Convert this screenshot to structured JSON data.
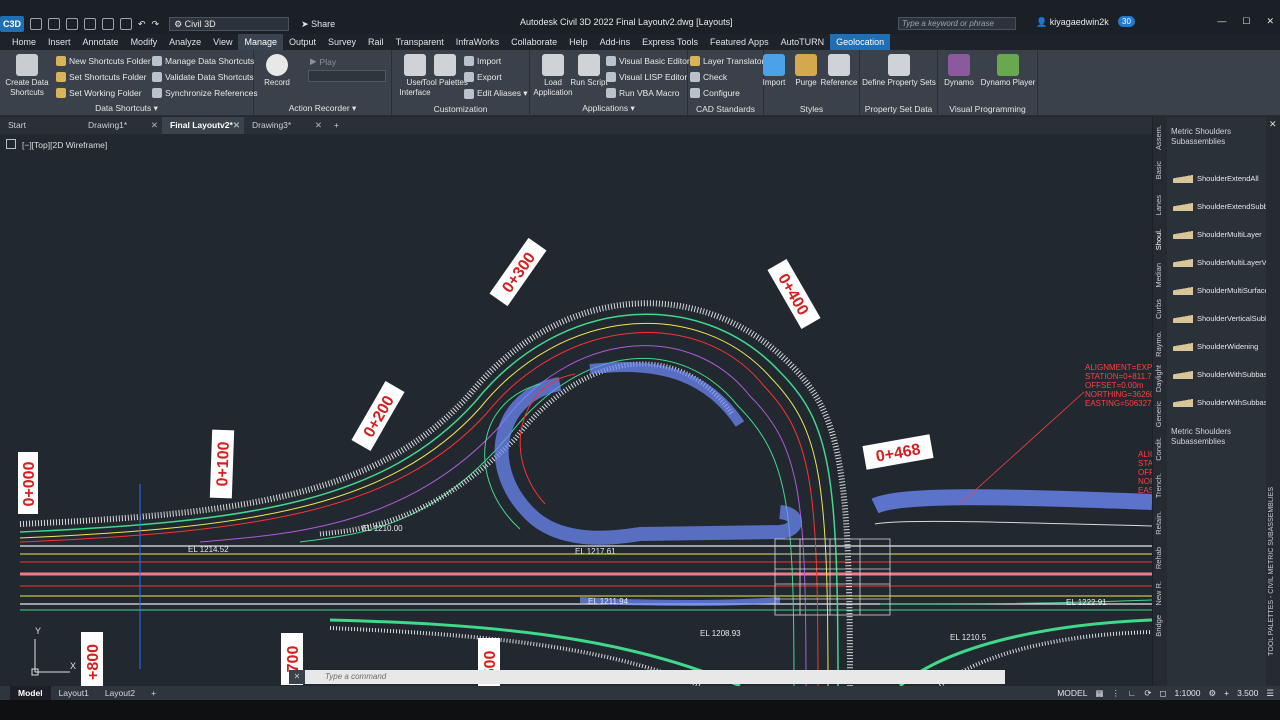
{
  "app": {
    "logo_text": "C3D",
    "workspace": "Civil 3D",
    "share_label": "Share",
    "title": "Autodesk Civil 3D 2022    Final Layoutv2.dwg [Layouts]",
    "search_placeholder": "Type a keyword or phrase",
    "user": "kiyagaedwin2k",
    "trial_days": "30"
  },
  "menu": [
    "Home",
    "Insert",
    "Annotate",
    "Modify",
    "Analyze",
    "View",
    "Manage",
    "Output",
    "Survey",
    "Rail",
    "Transparent",
    "InfraWorks",
    "Collaborate",
    "Help",
    "Add-ins",
    "Express Tools",
    "Featured Apps",
    "AutoTURN",
    "Geolocation"
  ],
  "ribbon": {
    "data_shortcuts": {
      "create": "Create Data Shortcuts",
      "new_folder": "New Shortcuts Folder",
      "set_folder": "Set Shortcuts Folder",
      "set_working": "Set Working Folder",
      "manage": "Manage Data Shortcuts",
      "validate": "Validate Data Shortcuts",
      "sync": "Synchronize References",
      "title": "Data Shortcuts ▾"
    },
    "action_recorder": {
      "record": "Record",
      "play": "Play",
      "title": "Action Recorder ▾"
    },
    "customization": {
      "ui": "User Interface",
      "tool": "Tool Palettes",
      "import": "Import",
      "export": "Export",
      "aliases": "Edit Aliases ▾",
      "title": "Customization"
    },
    "applications": {
      "load": "Load Application",
      "run": "Run Script",
      "vbe": "Visual Basic Editor",
      "vlisp": "Visual LISP Editor",
      "vba": "Run VBA Macro",
      "title": "Applications ▾"
    },
    "cad": {
      "layer": "Layer Translator",
      "check": "Check",
      "configure": "Configure",
      "title": "CAD Standards"
    },
    "styles": {
      "import": "Import",
      "purge": "Purge",
      "reference": "Reference",
      "title": "Styles"
    },
    "psd": {
      "define": "Define Property Sets",
      "title": "Property Set Data"
    },
    "vp": {
      "dynamo": "Dynamo",
      "player": "Dynamo Player",
      "title": "Visual Programming"
    }
  },
  "doc_tabs": [
    {
      "label": "Start",
      "active": false
    },
    {
      "label": "Drawing1*",
      "active": false
    },
    {
      "label": "Final Layoutv2*",
      "active": true
    },
    {
      "label": "Drawing3*",
      "active": false
    }
  ],
  "viewport": {
    "label": "[−][Top][2D Wireframe]",
    "stations": [
      "0+000",
      "0+100",
      "0+200",
      "0+300",
      "0+400",
      "0+468",
      "+800",
      "700",
      "500"
    ],
    "elevations": [
      "EL 1210.00",
      "EL 1214.52",
      "EL 1217.61",
      "EL 1211.94",
      "EL 1208.93",
      "EL 1222.91",
      "EL 1210.5"
    ],
    "annotation": [
      "ALIGNMENT=EXPR",
      "STATION=0+811.7",
      "OFFSET=0.00m",
      "NORTHING=36260",
      "EASTING=506327"
    ],
    "annotation2": [
      "ALIGN",
      "STATI",
      "OFF",
      "NOR",
      "EAS"
    ]
  },
  "palette": {
    "tabs": [
      "Assem.",
      "Basic",
      "Lanes",
      "Shoul.",
      "Median",
      "Curbs",
      "Raymo.",
      "Daylight",
      "Generic",
      "Condit.",
      "Trench.",
      "Retain.",
      "Rehab",
      "New R.",
      "Bridge"
    ],
    "header": "Metric Shoulders Subassemblies",
    "items": [
      "ShoulderExtendAll",
      "ShoulderExtendSubbase",
      "ShoulderMultiLayer",
      "ShoulderMultiLayerVarying...",
      "ShoulderMultiSurface",
      "ShoulderVerticalSubbase",
      "ShoulderWidening",
      "ShoulderWithSubbaseInterl...",
      "ShoulderWithSubbaseInterl..."
    ],
    "footer": "Metric Shoulders Subassemblies",
    "side_title": "TOOL PALETTES - CIVIL METRIC SUBASSEMBLIES"
  },
  "command": {
    "placeholder": "Type a command"
  },
  "status": {
    "layouts": [
      "Model",
      "Layout1",
      "Layout2"
    ],
    "model": "MODEL",
    "scale": "1:1000",
    "value": "3.500"
  }
}
